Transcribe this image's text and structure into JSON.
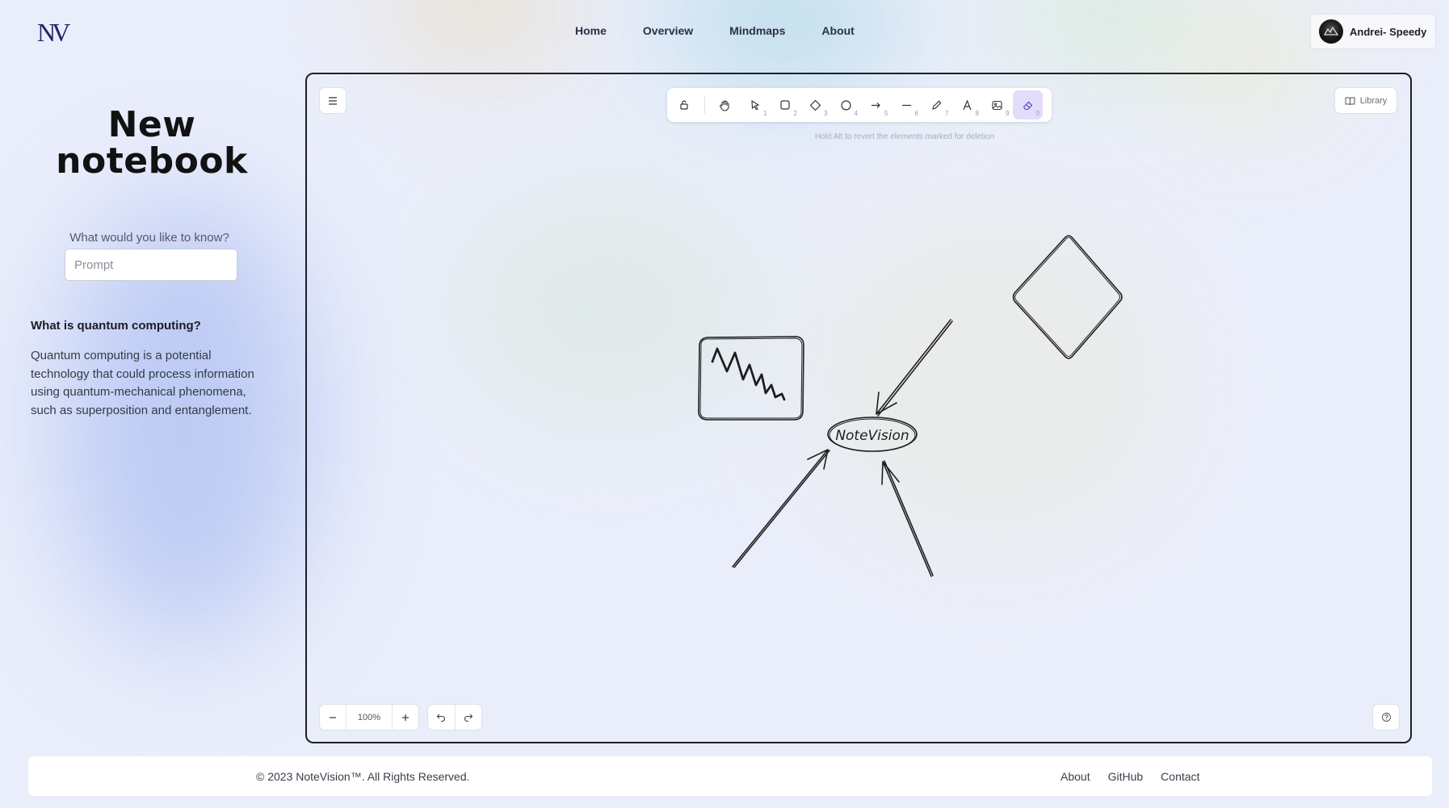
{
  "header": {
    "logo": "NV",
    "nav": [
      {
        "label": "Home"
      },
      {
        "label": "Overview"
      },
      {
        "label": "Mindmaps"
      },
      {
        "label": "About"
      }
    ],
    "user": {
      "name": "Andrei- Speedy",
      "avatar_icon": "user-avatar"
    }
  },
  "sidebar": {
    "title": "New notebook",
    "prompt_label": "What would you like to know?",
    "prompt_placeholder": "Prompt",
    "prompt_value": "",
    "question": "What is quantum computing?",
    "answer": "Quantum computing is a potential technology that could process information using quantum-mechanical phenomena, such as superposition and entanglement."
  },
  "canvas": {
    "menu_icon": "hamburger-menu-icon",
    "tools": [
      {
        "name": "lock",
        "key": ""
      },
      {
        "name": "hand",
        "key": ""
      },
      {
        "name": "selection",
        "key": "1"
      },
      {
        "name": "rectangle",
        "key": "2"
      },
      {
        "name": "diamond",
        "key": "3"
      },
      {
        "name": "ellipse",
        "key": "4"
      },
      {
        "name": "arrow",
        "key": "5"
      },
      {
        "name": "line",
        "key": "6"
      },
      {
        "name": "draw",
        "key": "7"
      },
      {
        "name": "text",
        "key": "8"
      },
      {
        "name": "image",
        "key": "9"
      },
      {
        "name": "eraser",
        "key": "0"
      }
    ],
    "active_tool": "eraser",
    "hint": "Hold Alt to revert the elements marked for deletion",
    "library_label": "Library",
    "drawing_text": "NoteVision",
    "zoom": "100%",
    "accent": "#e2ddfb"
  },
  "footer": {
    "copyright": "© 2023 NoteVision™. All Rights Reserved.",
    "links": [
      {
        "label": "About"
      },
      {
        "label": "GitHub"
      },
      {
        "label": "Contact"
      }
    ]
  }
}
